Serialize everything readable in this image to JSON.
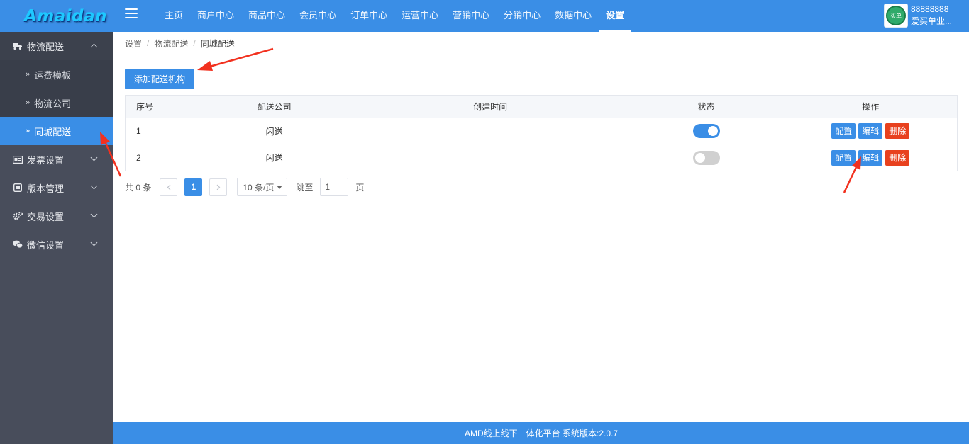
{
  "header": {
    "logo_text": "Amaidan",
    "menu_icon": "hamburger-menu-icon",
    "nav": [
      {
        "label": "主页"
      },
      {
        "label": "商户中心"
      },
      {
        "label": "商品中心"
      },
      {
        "label": "会员中心"
      },
      {
        "label": "订单中心"
      },
      {
        "label": "运营中心"
      },
      {
        "label": "营销中心"
      },
      {
        "label": "分销中心"
      },
      {
        "label": "数据中心"
      },
      {
        "label": "设置",
        "active": true
      }
    ],
    "user": {
      "avatar_text": "买单",
      "id": "88888888",
      "name": "爱买单业..."
    }
  },
  "sidebar": {
    "groups": [
      {
        "label": "物流配送",
        "icon": "truck-icon",
        "open": true,
        "items": [
          {
            "label": "运费模板"
          },
          {
            "label": "物流公司"
          },
          {
            "label": "同城配送",
            "active": true
          }
        ]
      },
      {
        "label": "发票设置",
        "icon": "invoice-icon"
      },
      {
        "label": "版本管理",
        "icon": "version-icon"
      },
      {
        "label": "交易设置",
        "icon": "gears-icon"
      },
      {
        "label": "微信设置",
        "icon": "wechat-icon"
      }
    ]
  },
  "breadcrumb": [
    "设置",
    "物流配送",
    "同城配送"
  ],
  "main": {
    "add_button": "添加配送机构",
    "table": {
      "headers": [
        "序号",
        "配送公司",
        "创建时间",
        "状态",
        "操作"
      ],
      "rows": [
        {
          "index": "1",
          "company": "闪送",
          "created": "",
          "enabled": true
        },
        {
          "index": "2",
          "company": "闪送",
          "created": "",
          "enabled": false
        }
      ],
      "actions": {
        "config": "配置",
        "edit": "编辑",
        "delete": "删除"
      }
    },
    "pagination": {
      "total_text": "共 0 条",
      "current_page": "1",
      "page_size": "10 条/页",
      "jump_label": "跳至",
      "jump_value": "1",
      "page_suffix": "页"
    }
  },
  "footer": {
    "text": "AMD线上线下一体化平台 系统版本:2.0.7"
  },
  "colors": {
    "primary": "#3a8ee6",
    "danger": "#e8411e",
    "sidebar": "#484d5b",
    "annotation_arrow": "#f2311f"
  }
}
